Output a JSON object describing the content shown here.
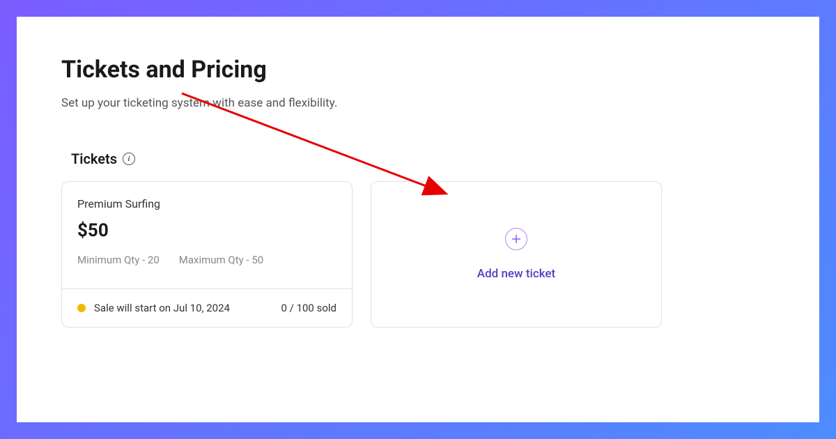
{
  "page": {
    "title": "Tickets and Pricing",
    "subtitle": "Set up your ticketing system with ease and flexibility."
  },
  "section": {
    "title": "Tickets"
  },
  "ticket": {
    "name": "Premium Surfing",
    "price": "$50",
    "min_qty_label": "Minimum Qty - 20",
    "max_qty_label": "Maximum Qty - 50",
    "sale_status": "Sale will start on Jul 10, 2024",
    "sold_count": "0 / 100 sold"
  },
  "add_card": {
    "label": "Add new ticket"
  }
}
